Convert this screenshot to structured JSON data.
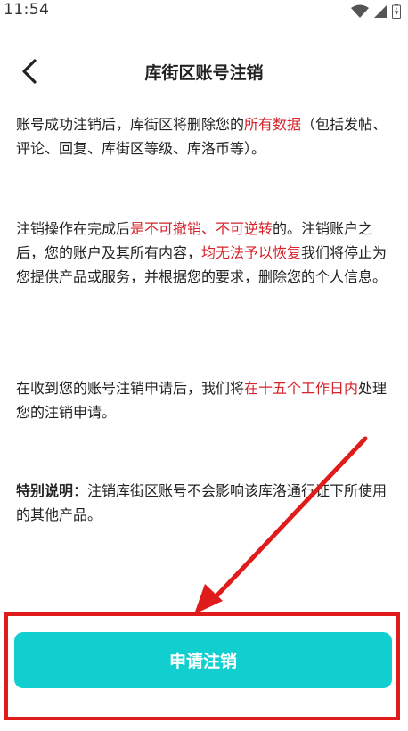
{
  "status_bar": {
    "time": "11:54"
  },
  "header": {
    "title": "库街区账号注销"
  },
  "paragraphs": {
    "p1": {
      "pre": "账号成功注销后，库街区将删除您的",
      "highlight": "所有数据",
      "post": "（包括发帖、评论、回复、库街区等级、库洛币等）。"
    },
    "p2": {
      "pre": "注销操作在完成后",
      "highlight1": "是不可撤销、不可逆转",
      "mid": "的。注销账户之后，您的账户及其所有内容，",
      "highlight2": "均无法予以恢复",
      "post": "我们将停止为您提供产品或服务，并根据您的要求，删除您的个人信息。"
    },
    "p3": {
      "pre": "在收到您的账号注销申请后，我们将",
      "highlight": "在十五个工作日内",
      "post": "处理您的注销申请。"
    },
    "p4": {
      "bold": "特别说明",
      "post": "：注销库街区账号不会影响该库洛通行证下所使用的其他产品。"
    }
  },
  "actions": {
    "apply_label": "申请注销"
  },
  "colors": {
    "accent": "#12cfcf",
    "highlight_text": "#d4232b",
    "annotation": "#e01b1b"
  },
  "icons": {
    "wifi": "wifi-icon",
    "signal": "signal-icon",
    "battery": "battery-icon",
    "back": "back-arrow-icon"
  }
}
